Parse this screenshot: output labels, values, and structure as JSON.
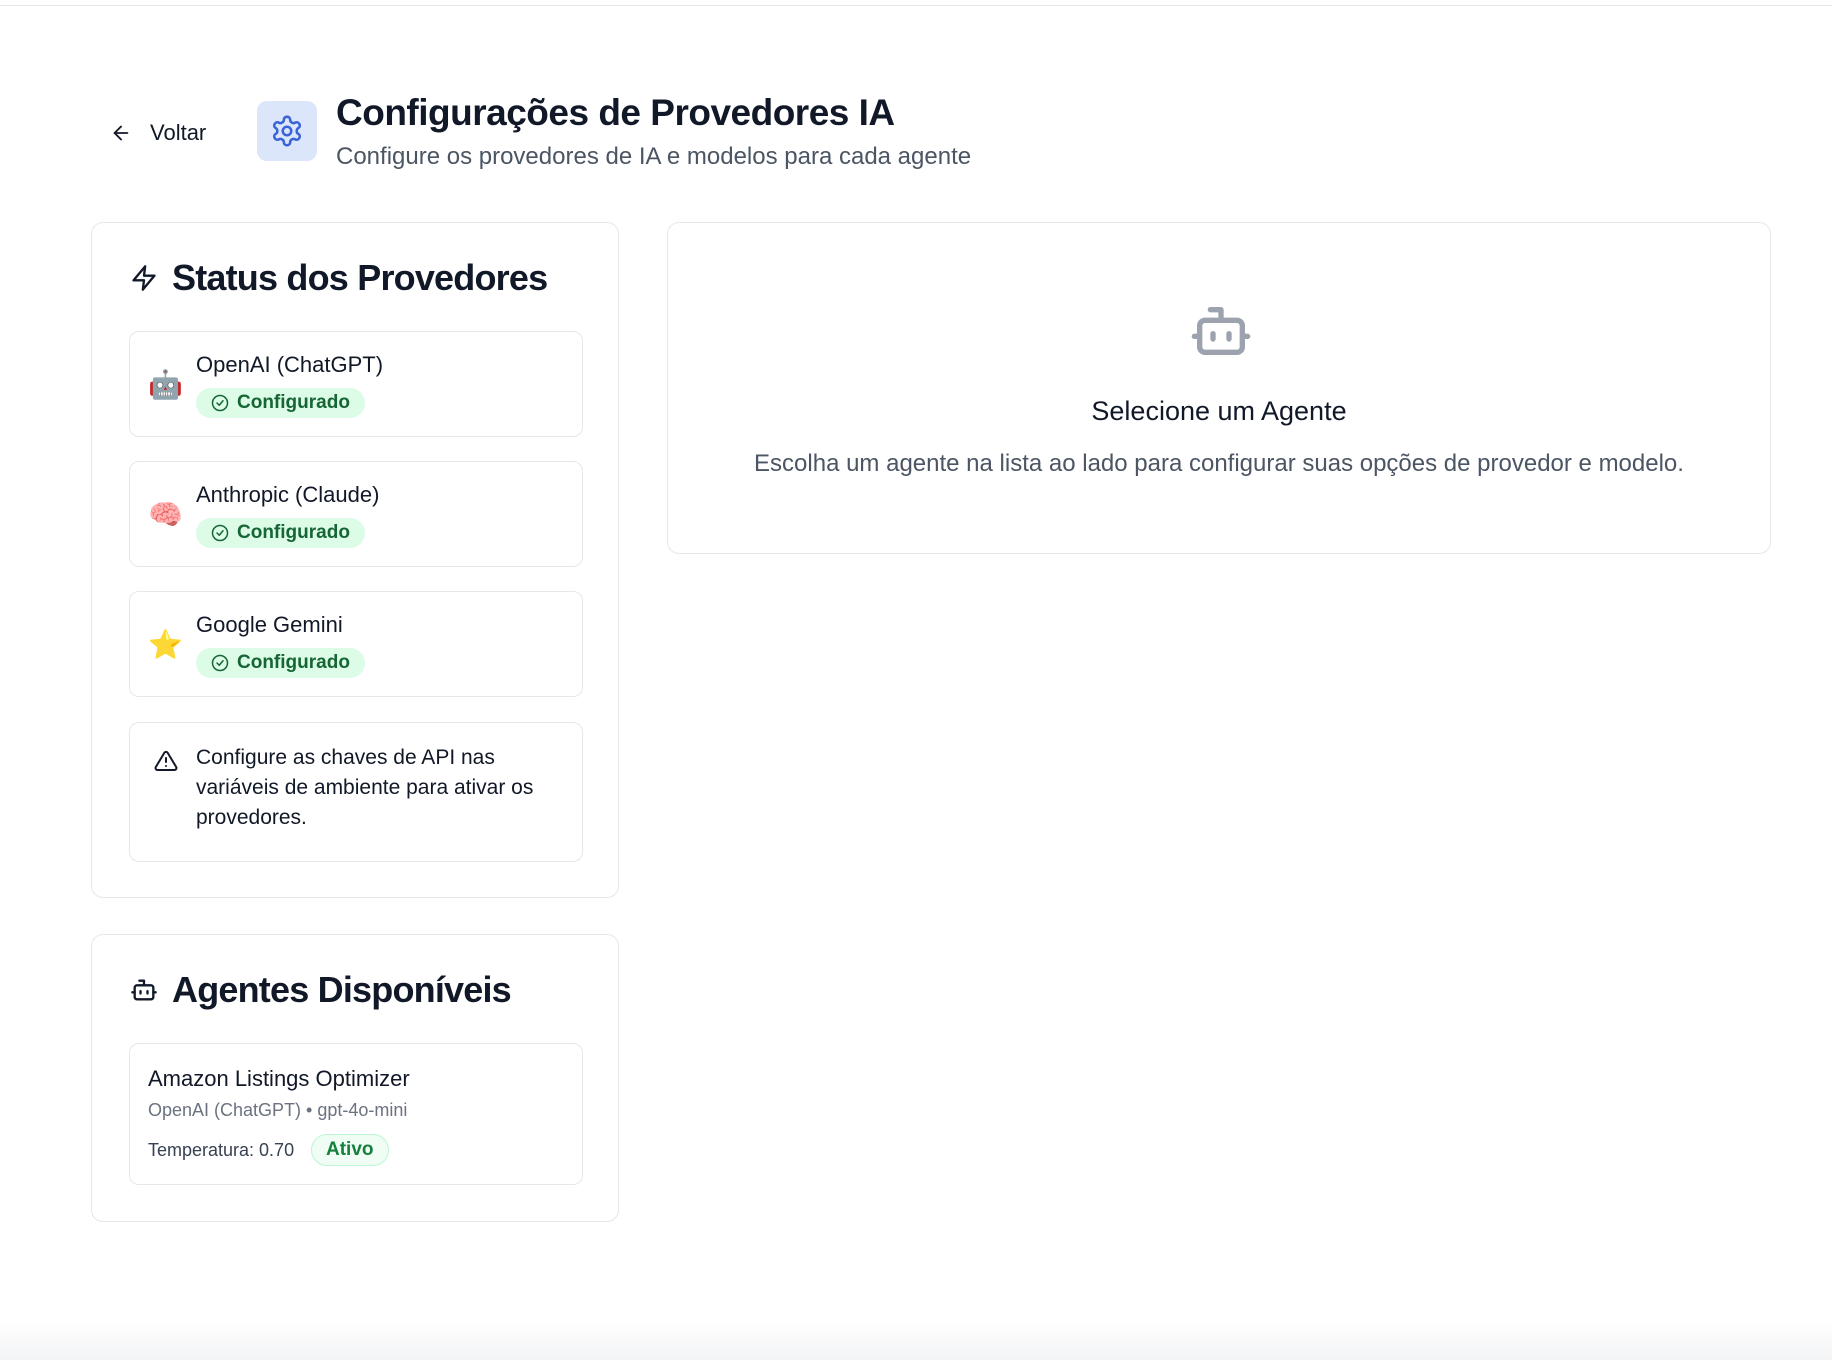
{
  "header": {
    "back_label": "Voltar",
    "title": "Configurações de Provedores IA",
    "subtitle": "Configure os provedores de IA e modelos para cada agente"
  },
  "status_panel": {
    "title": "Status dos Provedores",
    "providers": [
      {
        "emoji": "🤖",
        "name": "OpenAI (ChatGPT)",
        "status": "Configurado"
      },
      {
        "emoji": "🧠",
        "name": "Anthropic (Claude)",
        "status": "Configurado"
      },
      {
        "emoji": "⭐",
        "name": "Google Gemini",
        "status": "Configurado"
      }
    ],
    "warning": "Configure as chaves de API nas variáveis de ambiente para ativar os provedores."
  },
  "agents_panel": {
    "title": "Agentes Disponíveis",
    "agents": [
      {
        "name": "Amazon Listings Optimizer",
        "meta": "OpenAI (ChatGPT) • gpt-4o-mini",
        "temperature": "Temperatura: 0.70",
        "status": "Ativo"
      }
    ]
  },
  "empty_state": {
    "title": "Selecione um Agente",
    "description": "Escolha um agente na lista ao lado para configurar suas opções de provedor e modelo."
  },
  "colors": {
    "accent": "#3b63d8",
    "header_icon_bg": "#dbe6fb",
    "badge_bg": "#dcfce7",
    "badge_text": "#166534"
  },
  "icons": {
    "back": "arrow-left-icon",
    "header": "gear-icon",
    "status": "zap-icon",
    "warning": "alert-triangle-icon",
    "agents": "bot-icon",
    "empty": "bot-icon",
    "badge": "check-circle-icon"
  }
}
